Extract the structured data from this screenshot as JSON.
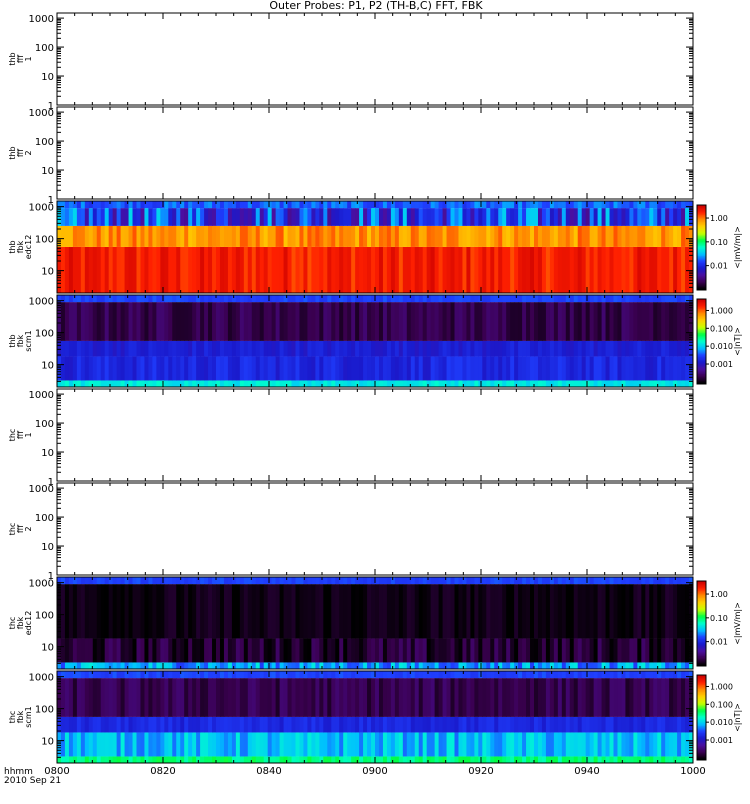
{
  "title": "Outer Probes: P1, P2 (TH-B,C) FFT, FBK",
  "colors": {
    "spectrogram_scale": [
      "#000000",
      "#3a0050",
      "#4b0fa0",
      "#1a1acc",
      "#1f3fff",
      "#00bfff",
      "#00ffcc",
      "#00ff44",
      "#c8ff00",
      "#ffd000",
      "#ff8c00",
      "#ff2000",
      "#cc0000"
    ],
    "axes": "#000000"
  },
  "chart_data": [
    {
      "type": "heatmap",
      "panel_label": [
        "thb",
        "fff",
        "1"
      ],
      "y_ticks": [
        "1",
        "10",
        "100",
        "1000"
      ],
      "ylim": [
        1,
        1500
      ],
      "y_scale": "log",
      "empty": true,
      "colorbar": null
    },
    {
      "type": "heatmap",
      "panel_label": [
        "thb",
        "fff",
        "2"
      ],
      "y_ticks": [
        "1",
        "10",
        "100",
        "1000"
      ],
      "ylim": [
        1,
        1500
      ],
      "y_scale": "log",
      "empty": true,
      "colorbar": null
    },
    {
      "type": "heatmap",
      "panel_label": [
        "thb",
        "fbk",
        "edc12"
      ],
      "y_ticks": [
        "10",
        "100",
        "1000"
      ],
      "ylim": [
        2,
        1500
      ],
      "y_scale": "log",
      "empty": false,
      "bands": [
        {
          "from": 2,
          "to": 55,
          "level": 0.93,
          "jitter": 0.05
        },
        {
          "from": 55,
          "to": 250,
          "level": 0.82,
          "jitter": 0.06
        },
        {
          "from": 250,
          "to": 900,
          "level": 0.3,
          "jitter": 0.15
        },
        {
          "from": 900,
          "to": 1500,
          "level": 0.35,
          "jitter": 0.05
        }
      ],
      "colorbar": {
        "ticks": [
          "1.00",
          "0.10",
          "0.01"
        ],
        "label": "<|mV/m|>"
      }
    },
    {
      "type": "heatmap",
      "panel_label": [
        "thb",
        "fbk",
        "scm1"
      ],
      "y_ticks": [
        "10",
        "100",
        "1000"
      ],
      "ylim": [
        2,
        1500
      ],
      "y_scale": "log",
      "empty": false,
      "bands": [
        {
          "from": 2,
          "to": 3.2,
          "level": 0.47,
          "jitter": 0.03
        },
        {
          "from": 3.2,
          "to": 18,
          "level": 0.28,
          "jitter": 0.04
        },
        {
          "from": 18,
          "to": 55,
          "level": 0.26,
          "jitter": 0.03
        },
        {
          "from": 55,
          "to": 900,
          "level": 0.08,
          "jitter": 0.04
        },
        {
          "from": 900,
          "to": 1500,
          "level": 0.33,
          "jitter": 0.02
        }
      ],
      "colorbar": {
        "ticks": [
          "1.000",
          "0.100",
          "0.010",
          "0.001"
        ],
        "label": "<|nT|>"
      }
    },
    {
      "type": "heatmap",
      "panel_label": [
        "thc",
        "fff",
        "1"
      ],
      "y_ticks": [
        "1",
        "10",
        "100",
        "1000"
      ],
      "ylim": [
        1,
        1500
      ],
      "y_scale": "log",
      "empty": true,
      "colorbar": null
    },
    {
      "type": "heatmap",
      "panel_label": [
        "thc",
        "fff",
        "2"
      ],
      "y_ticks": [
        "1",
        "10",
        "100",
        "1000"
      ],
      "ylim": [
        1,
        1500
      ],
      "y_scale": "log",
      "empty": true,
      "colorbar": null
    },
    {
      "type": "heatmap",
      "panel_label": [
        "thc",
        "fbk",
        "edc12"
      ],
      "y_ticks": [
        "10",
        "100",
        "1000"
      ],
      "ylim": [
        2,
        1500
      ],
      "y_scale": "log",
      "empty": false,
      "bands": [
        {
          "from": 2,
          "to": 3.2,
          "level": 0.4,
          "jitter": 0.08
        },
        {
          "from": 3.2,
          "to": 18,
          "level": 0.05,
          "jitter": 0.06
        },
        {
          "from": 18,
          "to": 900,
          "level": 0.02,
          "jitter": 0.03
        },
        {
          "from": 900,
          "to": 1500,
          "level": 0.33,
          "jitter": 0.02
        }
      ],
      "colorbar": {
        "ticks": [
          "1.00",
          "0.10",
          "0.01"
        ],
        "label": "<|mV/m|>"
      }
    },
    {
      "type": "heatmap",
      "panel_label": [
        "thc",
        "fbk",
        "scm1"
      ],
      "y_ticks": [
        "10",
        "100",
        "1000"
      ],
      "ylim": [
        2,
        1500
      ],
      "y_scale": "log",
      "empty": false,
      "bands": [
        {
          "from": 2,
          "to": 3.2,
          "level": 0.55,
          "jitter": 0.04
        },
        {
          "from": 3.2,
          "to": 18,
          "level": 0.42,
          "jitter": 0.06
        },
        {
          "from": 18,
          "to": 55,
          "level": 0.28,
          "jitter": 0.03
        },
        {
          "from": 55,
          "to": 900,
          "level": 0.08,
          "jitter": 0.04
        },
        {
          "from": 900,
          "to": 1500,
          "level": 0.33,
          "jitter": 0.02
        }
      ],
      "colorbar": {
        "ticks": [
          "1.000",
          "0.100",
          "0.010",
          "0.001"
        ],
        "label": "<|nT|>"
      }
    }
  ],
  "x_axis": {
    "ticks": [
      "0800",
      "0820",
      "0840",
      "0900",
      "0920",
      "0940",
      "1000"
    ],
    "row_label_1": "hhmm",
    "row_label_2": "2010 Sep 21"
  }
}
